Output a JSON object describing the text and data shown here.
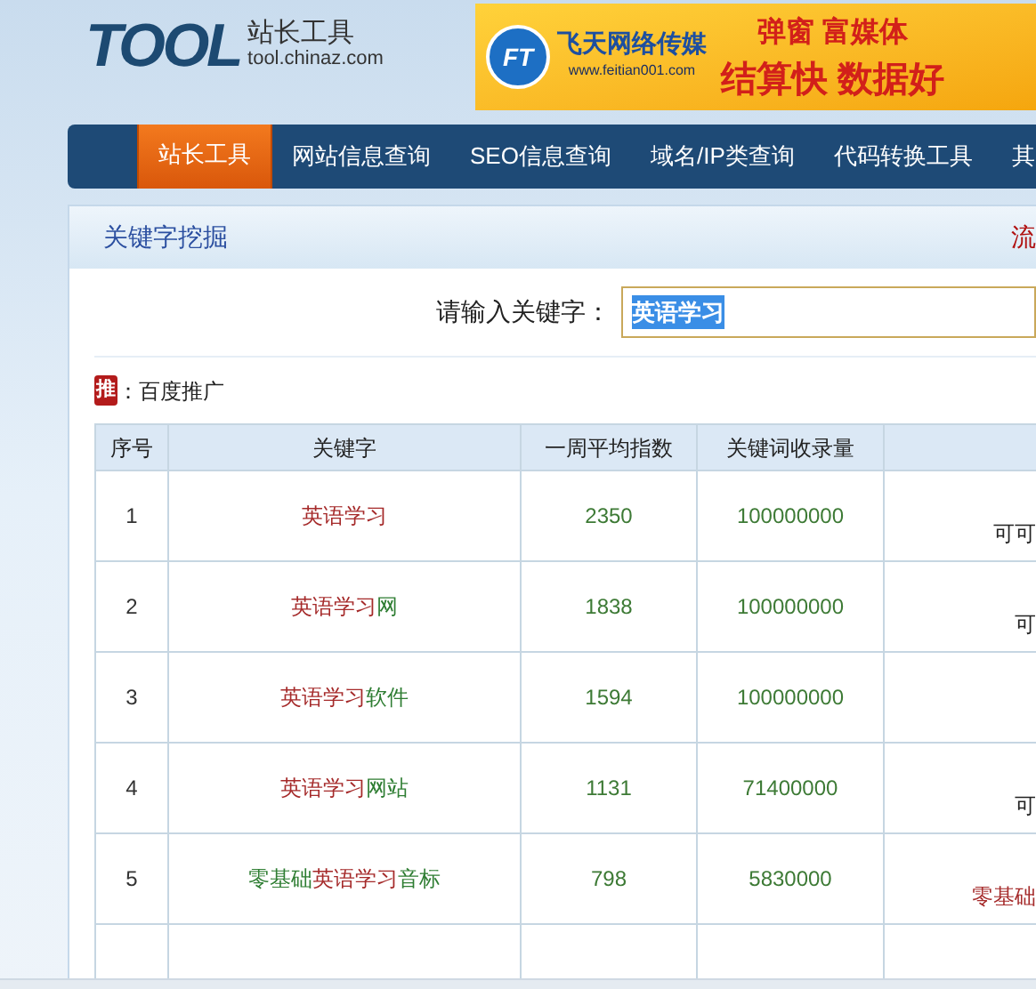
{
  "header": {
    "logo": "TOOL",
    "logo_title": "站长工具",
    "logo_url": "tool.chinaz.com",
    "ad": {
      "badge": "FT",
      "brand": "飞天网络传媒",
      "url": "www.feitian001.com",
      "line_1": "弹窗 富媒体",
      "line_2": "结算快 数据好"
    }
  },
  "nav": [
    {
      "label": "站长工具",
      "selected": true
    },
    {
      "label": "网站信息查询",
      "selected": false
    },
    {
      "label": "SEO信息查询",
      "selected": false
    },
    {
      "label": "域名/IP类查询",
      "selected": false
    },
    {
      "label": "代码转换工具",
      "selected": false
    },
    {
      "label": "其",
      "selected": false
    }
  ],
  "section": {
    "title": "关键字挖掘",
    "right_text": "流"
  },
  "search": {
    "label": "请输入关键字：",
    "value": "英语学习"
  },
  "promo": {
    "badge": "推",
    "text": "：百度推广"
  },
  "table": {
    "columns": [
      "序号",
      "关键字",
      "一周平均指数",
      "关键词收录量"
    ],
    "rows": [
      {
        "index": "1",
        "keyword": [
          {
            "text": "英语学习",
            "match": true
          }
        ],
        "index_avg": "2350",
        "count": "100000000",
        "column_5": [
          {
            "text": "可可",
            "match": false
          }
        ]
      },
      {
        "index": "2",
        "keyword": [
          {
            "text": "英语学习",
            "match": true
          },
          {
            "text": "网",
            "match": false
          }
        ],
        "index_avg": "1838",
        "count": "100000000",
        "column_5": [
          {
            "text": "可",
            "match": false
          }
        ]
      },
      {
        "index": "3",
        "keyword": [
          {
            "text": "英语学习",
            "match": true
          },
          {
            "text": "软件",
            "match": false
          }
        ],
        "index_avg": "1594",
        "count": "100000000",
        "column_5": []
      },
      {
        "index": "4",
        "keyword": [
          {
            "text": "英语学习",
            "match": true
          },
          {
            "text": "网站",
            "match": false
          }
        ],
        "index_avg": "1131",
        "count": "71400000",
        "column_5": [
          {
            "text": "可",
            "match": false
          }
        ]
      },
      {
        "index": "5",
        "keyword": [
          {
            "text": "零基础",
            "match": false
          },
          {
            "text": "英语学习",
            "match": true
          },
          {
            "text": "音标",
            "match": false
          }
        ],
        "index_avg": "798",
        "count": "5830000",
        "column_5": [
          {
            "text": "零基础",
            "match": true
          }
        ]
      }
    ]
  }
}
